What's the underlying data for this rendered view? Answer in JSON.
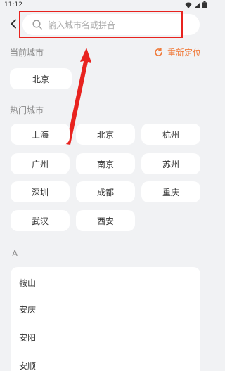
{
  "status_bar": {
    "time": "11:12"
  },
  "search": {
    "placeholder": "输入城市名或拼音"
  },
  "current_city": {
    "section_label": "当前城市",
    "relocate_label": "重新定位",
    "city": "北京"
  },
  "hot_cities": {
    "section_label": "热门城市",
    "cities": [
      "上海",
      "北京",
      "杭州",
      "广州",
      "南京",
      "苏州",
      "深圳",
      "成都",
      "重庆",
      "武汉",
      "西安"
    ]
  },
  "index_letter": "A",
  "city_list": [
    "鞍山",
    "安庆",
    "安阳",
    "安顺"
  ],
  "colors": {
    "accent": "#f07a3a",
    "highlight": "#e8231f"
  },
  "icons": [
    "wifi-icon",
    "signal-icon",
    "battery-icon",
    "back-arrow-icon",
    "search-icon",
    "refresh-icon"
  ]
}
